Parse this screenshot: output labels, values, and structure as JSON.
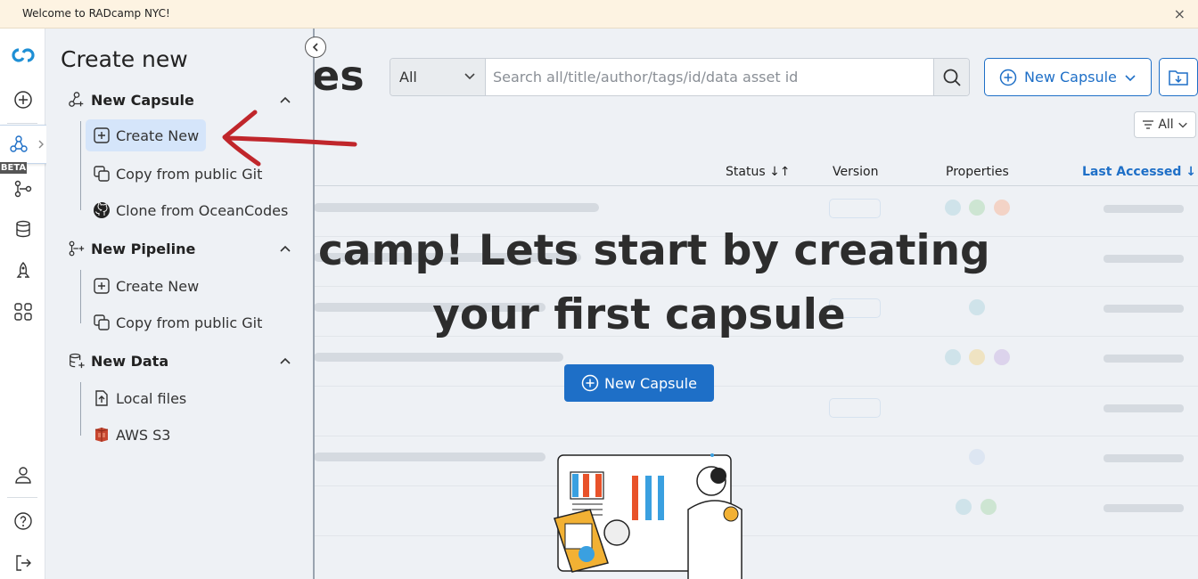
{
  "banner": {
    "text": "Welcome to RADcamp NYC!",
    "close": "×"
  },
  "rail": {
    "beta_label": "BETA",
    "icons": [
      "logo-icon",
      "plus-icon",
      "capsule-icon",
      "pipeline-icon",
      "data-icon",
      "rocket-icon",
      "apps-icon",
      "user-icon",
      "help-icon",
      "logout-icon"
    ]
  },
  "drawer": {
    "title": "Create new",
    "sections": [
      {
        "label": "New Capsule",
        "items": [
          "Create New",
          "Copy from public Git",
          "Clone from OceanCodes"
        ]
      },
      {
        "label": "New Pipeline",
        "items": [
          "Create New",
          "Copy from public Git"
        ]
      },
      {
        "label": "New Data",
        "items": [
          "Local files",
          "AWS S3"
        ]
      }
    ]
  },
  "main": {
    "title_partial": "es",
    "search": {
      "scope": "All",
      "placeholder": "Search all/title/author/tags/id/data asset id"
    },
    "new_capsule_label": "New Capsule",
    "filter_label": "All",
    "columns": {
      "status": "Status",
      "version": "Version",
      "properties": "Properties",
      "last_accessed": "Last Accessed"
    },
    "welcome_text": "dcamp! Lets start by creating your first capsule",
    "cta_label": "New Capsule"
  },
  "colors": {
    "accent": "#1e6fc7",
    "banner": "#fdf3e2",
    "drawer_bg": "#eef1f5",
    "active_item": "#d5e5fa",
    "arrow": "#c0262b"
  }
}
